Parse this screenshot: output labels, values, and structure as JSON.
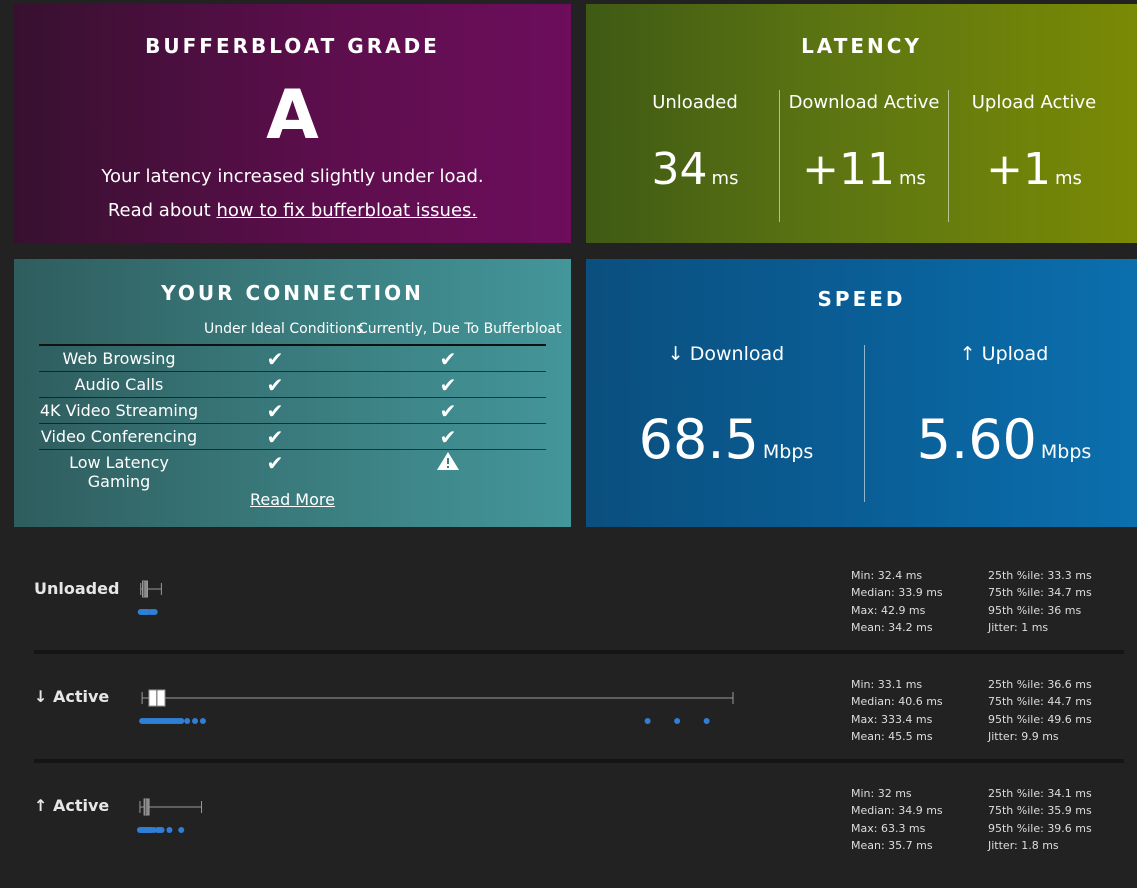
{
  "grade": {
    "title": "BUFFERBLOAT GRADE",
    "letter": "A",
    "message": "Your latency increased slightly under load.",
    "read_prefix": "Read about ",
    "read_link": "how to fix bufferbloat issues."
  },
  "latency": {
    "title": "LATENCY",
    "unit": "ms",
    "columns": [
      {
        "label": "Unloaded",
        "value": "34"
      },
      {
        "label": "Download Active",
        "value": "+11"
      },
      {
        "label": "Upload Active",
        "value": "+1"
      }
    ]
  },
  "connection": {
    "title": "YOUR CONNECTION",
    "col_ideal": "Under Ideal Conditions",
    "col_current": "Currently, Due To Bufferbloat",
    "rows": [
      {
        "name": "Web Browsing",
        "ideal": "ok",
        "current": "ok"
      },
      {
        "name": "Audio Calls",
        "ideal": "ok",
        "current": "ok"
      },
      {
        "name": "4K Video Streaming",
        "ideal": "ok",
        "current": "ok"
      },
      {
        "name": "Video Conferencing",
        "ideal": "ok",
        "current": "ok"
      },
      {
        "name": "Low Latency Gaming",
        "ideal": "ok",
        "current": "warning"
      }
    ],
    "read_more": "Read More"
  },
  "speed": {
    "title": "SPEED",
    "unit": "Mbps",
    "download": {
      "label": "↓ Download",
      "value": "68.5"
    },
    "upload": {
      "label": "↑ Upload",
      "value": "5.60"
    }
  },
  "colors": {
    "grade_bg": "#5c0e4c",
    "latency_bg": "#5c7512",
    "connection_bg": "#3a7b7d",
    "speed_bg": "#0a5e96",
    "dot_blue": "#2f7fd6"
  },
  "stats": [
    {
      "label": "Unloaded",
      "min": "Min: 32.4 ms",
      "median": "Median: 33.9 ms",
      "max": "Max: 42.9 ms",
      "mean": "Mean: 34.2 ms",
      "p25": "25th %ile: 33.3 ms",
      "p75": "75th %ile: 34.7 ms",
      "p95": "95th %ile: 36 ms",
      "jitter": "Jitter: 1 ms",
      "box": {
        "min": 32.4,
        "q1": 33.3,
        "median": 33.9,
        "q3": 34.7,
        "max": 42.9
      }
    },
    {
      "label": "↓ Active",
      "min": "Min: 33.1 ms",
      "median": "Median: 40.6 ms",
      "max": "Max: 333.4 ms",
      "mean": "Mean: 45.5 ms",
      "p25": "25th %ile: 36.6 ms",
      "p75": "75th %ile: 44.7 ms",
      "p95": "95th %ile: 49.6 ms",
      "jitter": "Jitter: 9.9 ms",
      "box": {
        "min": 33.1,
        "q1": 36.6,
        "median": 40.6,
        "q3": 44.7,
        "max": 333.4
      }
    },
    {
      "label": "↑ Active",
      "min": "Min: 32 ms",
      "median": "Median: 34.9 ms",
      "max": "Max: 63.3 ms",
      "mean": "Mean: 35.7 ms",
      "p25": "25th %ile: 34.1 ms",
      "p75": "75th %ile: 35.9 ms",
      "p95": "95th %ile: 39.6 ms",
      "jitter": "Jitter: 1.8 ms",
      "box": {
        "min": 32,
        "q1": 34.1,
        "median": 34.9,
        "q3": 35.9,
        "max": 63.3
      }
    }
  ]
}
